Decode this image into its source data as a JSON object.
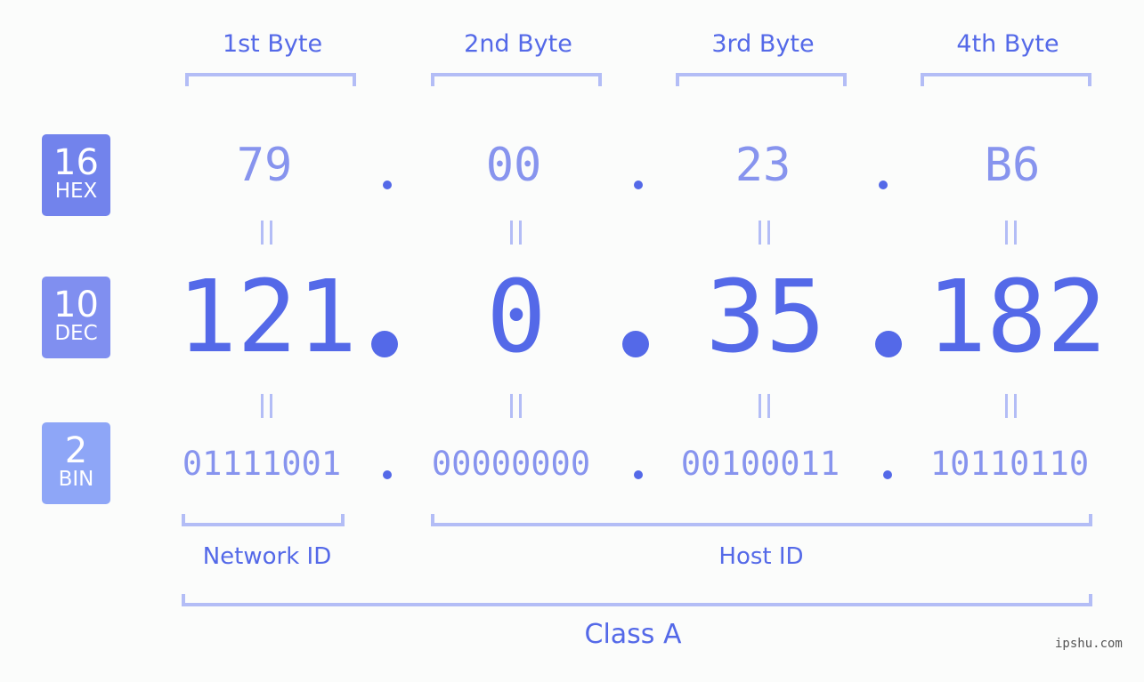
{
  "rows": [
    {
      "base": "16",
      "label": "HEX",
      "color": "#7283ec"
    },
    {
      "base": "10",
      "label": "DEC",
      "color": "#808ff0"
    },
    {
      "base": "2",
      "label": "BIN",
      "color": "#8ea6f7"
    }
  ],
  "bytes": [
    {
      "label": "1st Byte",
      "hex": "79",
      "dec": "121",
      "bin": "01111001"
    },
    {
      "label": "2nd Byte",
      "hex": "00",
      "dec": "0",
      "bin": "00000000"
    },
    {
      "label": "3rd Byte",
      "hex": "23",
      "dec": "35",
      "bin": "00100011"
    },
    {
      "label": "4th Byte",
      "hex": "B6",
      "dec": "182",
      "bin": "10110110"
    }
  ],
  "segments": {
    "network": "Network ID",
    "host": "Host ID",
    "class": "Class A"
  },
  "watermark": "ipshu.com",
  "colors": {
    "accent": "#5469e8",
    "light": "#8794ee",
    "bracket": "#b3bdf6"
  }
}
